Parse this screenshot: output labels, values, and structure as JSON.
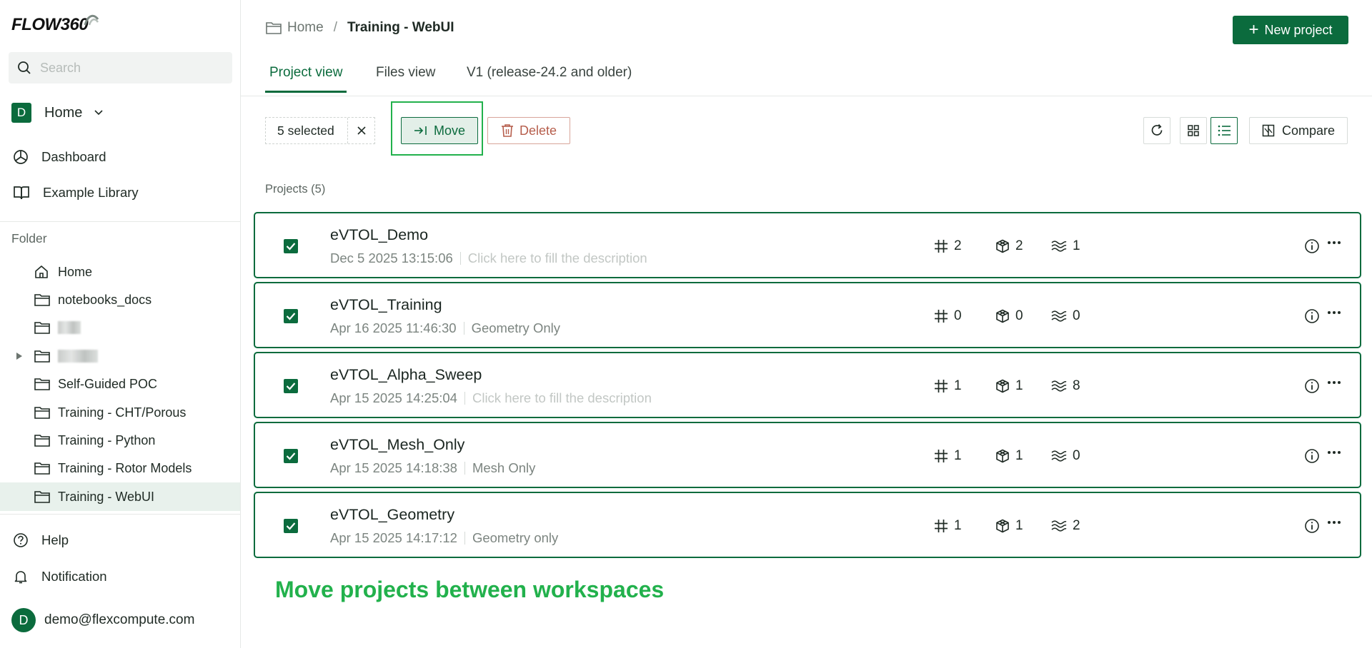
{
  "app": {
    "logo_text": "FLOW360"
  },
  "sidebar": {
    "search_placeholder": "Search",
    "workspace": {
      "avatar": "D",
      "label": "Home"
    },
    "nav": [
      {
        "label": "Dashboard",
        "icon": "pie-chart-icon"
      },
      {
        "label": "Example Library",
        "icon": "book-icon"
      }
    ],
    "folder_heading": "Folder",
    "folders": [
      {
        "label": "Home",
        "icon": "home-icon"
      },
      {
        "label": "notebooks_docs",
        "icon": "folder-icon"
      },
      {
        "label": "",
        "icon": "folder-icon",
        "redacted": true
      },
      {
        "label": "",
        "icon": "folder-icon",
        "redacted": true,
        "expandable": true
      },
      {
        "label": "Self-Guided POC",
        "icon": "folder-icon"
      },
      {
        "label": "Training - CHT/Porous",
        "icon": "folder-icon"
      },
      {
        "label": "Training - Python",
        "icon": "folder-icon"
      },
      {
        "label": "Training - Rotor Models",
        "icon": "folder-icon"
      },
      {
        "label": "Training - WebUI",
        "icon": "folder-icon",
        "active": true
      }
    ],
    "bottom": [
      {
        "label": "Help",
        "icon": "help-icon"
      },
      {
        "label": "Notification",
        "icon": "bell-icon"
      }
    ],
    "user": {
      "avatar": "D",
      "email": "demo@flexcompute.com"
    }
  },
  "header": {
    "breadcrumb_home": "Home",
    "breadcrumb_sep": "/",
    "breadcrumb_current": "Training - WebUI",
    "new_project_label": "New project"
  },
  "tabs": [
    {
      "label": "Project view",
      "active": true
    },
    {
      "label": "Files view"
    },
    {
      "label": "V1 (release-24.2 and older)"
    }
  ],
  "toolbar": {
    "selected_label": "5 selected",
    "move_label": "Move",
    "delete_label": "Delete",
    "compare_label": "Compare"
  },
  "projects_heading": "Projects (5)",
  "projects": [
    {
      "name": "eVTOL_Demo",
      "date": "Dec 5 2025 13:15:06",
      "description": "Click here to fill the description",
      "placeholder": true,
      "mesh": "2",
      "geometry": "2",
      "case": "1"
    },
    {
      "name": "eVTOL_Training",
      "date": "Apr 16 2025 11:46:30",
      "description": "Geometry Only",
      "placeholder": false,
      "mesh": "0",
      "geometry": "0",
      "case": "0"
    },
    {
      "name": "eVTOL_Alpha_Sweep",
      "date": "Apr 15 2025 14:25:04",
      "description": "Click here to fill the description",
      "placeholder": true,
      "mesh": "1",
      "geometry": "1",
      "case": "8"
    },
    {
      "name": "eVTOL_Mesh_Only",
      "date": "Apr 15 2025 14:18:38",
      "description": "Mesh Only",
      "placeholder": false,
      "mesh": "1",
      "geometry": "1",
      "case": "0"
    },
    {
      "name": "eVTOL_Geometry",
      "date": "Apr 15 2025 14:17:12",
      "description": "Geometry only",
      "placeholder": false,
      "mesh": "1",
      "geometry": "1",
      "case": "2"
    }
  ],
  "caption": "Move projects between workspaces",
  "colors": {
    "brand": "#0b6b3d",
    "highlight": "#22b14c",
    "danger": "#b65e4c"
  }
}
